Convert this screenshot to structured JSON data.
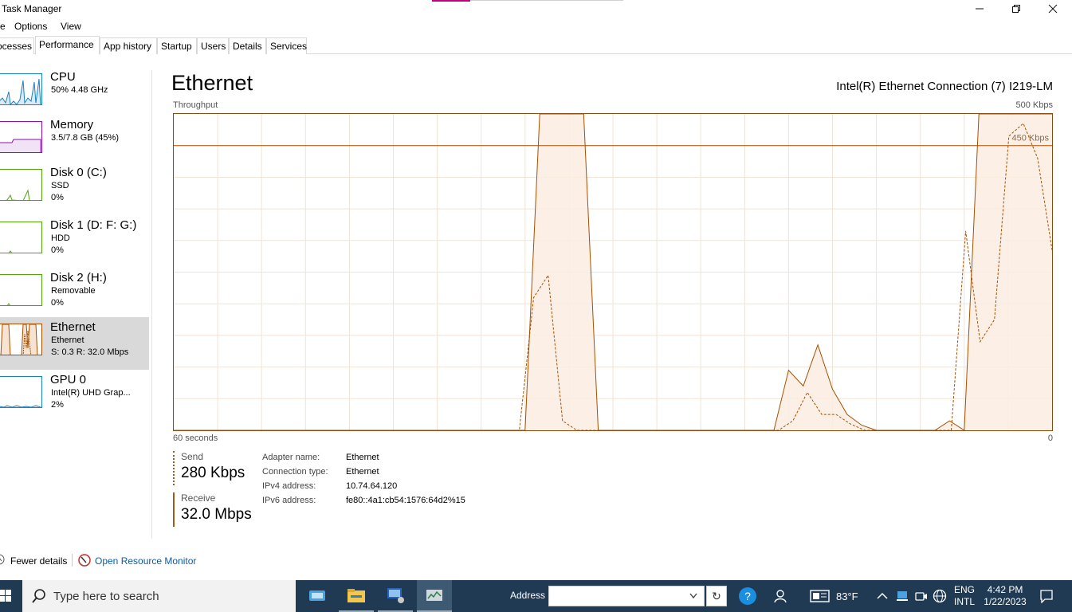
{
  "window": {
    "title": "Task Manager",
    "menu": [
      "e",
      "Options",
      "View"
    ]
  },
  "tabs": [
    "ocesses",
    "Performance",
    "App history",
    "Startup",
    "Users",
    "Details",
    "Services"
  ],
  "active_tab": "Performance",
  "sidebar": [
    {
      "name": "CPU",
      "sub1": "50%  4.48 GHz",
      "sub2": "",
      "color": "#1782c4"
    },
    {
      "name": "Memory",
      "sub1": "3.5/7.8 GB (45%)",
      "sub2": "",
      "color": "#8b12ae"
    },
    {
      "name": "Disk 0 (C:)",
      "sub1": "SSD",
      "sub2": "0%",
      "color": "#4da60c"
    },
    {
      "name": "Disk 1 (D: F: G:)",
      "sub1": "HDD",
      "sub2": "0%",
      "color": "#4da60c"
    },
    {
      "name": "Disk 2 (H:)",
      "sub1": "Removable",
      "sub2": "0%",
      "color": "#4da60c"
    },
    {
      "name": "Ethernet",
      "sub1": "Ethernet",
      "sub2": "S: 0.3  R: 32.0 Mbps",
      "color": "#a74f01"
    },
    {
      "name": "GPU 0",
      "sub1": "Intel(R) UHD Grap...",
      "sub2": "2%",
      "color": "#1782c4"
    }
  ],
  "main": {
    "title": "Ethernet",
    "adapter_description": "Intel(R) Ethernet Connection (7) I219-LM",
    "graph_label": "Throughput",
    "graph_max": "500 Kbps",
    "graph_marker": "450 Kbps",
    "graph_time": "60 seconds",
    "graph_zero": "0",
    "send_label": "Send",
    "send_value": "280 Kbps",
    "receive_label": "Receive",
    "receive_value": "32.0 Mbps",
    "properties": [
      {
        "label": "Adapter name:",
        "value": "Ethernet"
      },
      {
        "label": "Connection type:",
        "value": "Ethernet"
      },
      {
        "label": "IPv4 address:",
        "value": "10.74.64.120"
      },
      {
        "label": "IPv6 address:",
        "value": "fe80::4a1:cb54:1576:64d2%15"
      }
    ]
  },
  "footer": {
    "fewer_details": "Fewer details",
    "open_resource_monitor": "Open Resource Monitor"
  },
  "taskbar": {
    "search_placeholder": "Type here to search",
    "address_label": "Address",
    "weather": "83°F",
    "lang1": "ENG",
    "lang2": "INTL",
    "time": "4:42 PM",
    "date": "1/22/2023"
  },
  "chart_data": {
    "type": "line",
    "title": "Throughput",
    "y_unit": "Kbps",
    "ylim": [
      0,
      500
    ],
    "xlim": [
      60,
      0
    ],
    "xlabel": "60 seconds",
    "grid": true,
    "series": [
      {
        "style": "solid",
        "values": [
          0,
          0,
          0,
          0,
          0,
          0,
          0,
          0,
          0,
          0,
          0,
          0,
          0,
          0,
          0,
          0,
          0,
          0,
          0,
          0,
          0,
          0,
          0,
          0,
          0,
          500,
          500,
          500,
          500,
          0,
          0,
          0,
          0,
          0,
          0,
          0,
          0,
          0,
          0,
          0,
          0,
          0,
          95,
          70,
          135,
          65,
          25,
          8,
          0,
          0,
          0,
          0,
          0,
          15,
          0,
          500,
          500,
          500,
          500,
          500,
          500
        ]
      },
      {
        "style": "dotted",
        "values": [
          0,
          0,
          0,
          0,
          0,
          0,
          0,
          0,
          0,
          0,
          0,
          0,
          0,
          0,
          0,
          0,
          0,
          0,
          0,
          0,
          0,
          0,
          0,
          0,
          0,
          210,
          245,
          15,
          0,
          0,
          0,
          0,
          0,
          0,
          0,
          0,
          0,
          0,
          0,
          0,
          0,
          0,
          0,
          15,
          60,
          25,
          25,
          10,
          0,
          0,
          0,
          0,
          0,
          0,
          0,
          315,
          140,
          175,
          465,
          485,
          430,
          285
        ]
      }
    ]
  }
}
